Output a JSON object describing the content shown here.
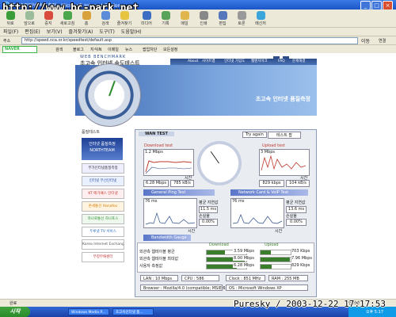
{
  "window": {
    "title": "Microsoft Internet Explorer",
    "title_prefix": "초고속인터넷 속도측정"
  },
  "watermark": "http://www.bc-park.net",
  "credit": "Puresky / 2003-12-22 17:17:53",
  "toolbar": {
    "items": [
      "뒤로",
      "앞으로",
      "중지",
      "새로고침",
      "홈",
      "검색",
      "즐겨찾기",
      "미디어",
      "기록",
      "메일",
      "인쇄",
      "편집",
      "토론",
      "메신저"
    ]
  },
  "menubar": [
    "파일(F)",
    "편집(E)",
    "보기(V)",
    "즐겨찾기(A)",
    "도구(T)",
    "도움말(H)"
  ],
  "address": {
    "label": "주소",
    "value": "http://speed.nca.or.kr/speedtest/default.asp",
    "go": "이동",
    "links": "연결"
  },
  "linkbar": {
    "search_brand": "NAVER",
    "search_label": "검색",
    "items": [
      "블로그",
      "지식iN",
      "이메일",
      "뉴스",
      "팝업차단",
      "모든설정"
    ]
  },
  "site": {
    "logo": "WEB BENCHMARK",
    "subtitle": "초고속 인터넷 속도테스트",
    "nav": [
      "About",
      "사이트맵",
      "인터넷 가입도",
      "웹벤치마크",
      "FAQ",
      "문제해결"
    ],
    "banner": "초고속 인터넷 품질측정"
  },
  "side": {
    "heading": "품질테스트",
    "big": [
      "인터넷 품질측정",
      "NORTHTEAM"
    ],
    "items": [
      "부가인터넷품질측정",
      "인터넷 무선인터넷",
      "KT 메가패스 인터넷",
      "온세통신 Hanafos",
      "하나로통신 하나포스",
      "두루넷 TV 서비스",
      "Korea Internet Exchange",
      "부정부패센터"
    ]
  },
  "panel": {
    "tab": "WAN TEST",
    "try_again": "Try again",
    "tab2": "테스트 팝",
    "download": {
      "title": "Download test",
      "unit_top": "1.2 Mbps",
      "time": "시간",
      "speed": "6.28 Mbps",
      "bytes": "785 kB/s"
    },
    "upload": {
      "title": "Upload test",
      "unit_top": "3 Mbps",
      "time": "시간",
      "speed": "829 kbps",
      "bytes": "104 kB/s"
    },
    "strips": [
      "General Ping Test",
      "Network Card & VoIP Test",
      "Bandwidth Gauge"
    ],
    "ping_left": {
      "axis": "76 ms",
      "avg_label": "평균 지연값",
      "avg": "11.5 ms",
      "loss_label": "손실율",
      "loss": "0.00%",
      "time": "시간"
    },
    "ping_right": {
      "axis": "76 ms",
      "avg_label": "평균 지연값",
      "avg": "13.6 ms",
      "loss_label": "손실율",
      "loss": "0.00%",
      "time": "시간"
    },
    "compare": {
      "head_down": "Download",
      "head_up": "Upload",
      "rows": [
        {
          "label": "외관측 웹테이블 평균",
          "down": "3.59 Mbps",
          "down_frac": 0.45,
          "up": "703 Kbps",
          "up_frac": 0.35
        },
        {
          "label": "외관측 웹테이블 최대값",
          "down": "8.00 Mbps",
          "down_frac": 0.95,
          "up": "7.96 Mbps",
          "up_frac": 0.98
        },
        {
          "label": "사용자 측정값",
          "down": "6.28 Mbps",
          "down_frac": 0.75,
          "up": "829 Kbps",
          "up_frac": 0.38
        }
      ]
    },
    "info": [
      {
        "key": "LAN",
        "value": "10 Mbps"
      },
      {
        "key": "CPU",
        "value": "586"
      },
      {
        "key": "Clock",
        "value": "851 MHz"
      },
      {
        "key": "RAM",
        "value": "255 MB"
      },
      {
        "key": "Browser",
        "value": "Mozilla/4.0 (compatible; MSIE 6.0)"
      },
      {
        "key": "OS",
        "value": "Microsoft Windows XP"
      }
    ]
  },
  "status": {
    "text": "완료",
    "zone": "인터넷"
  },
  "taskbar": {
    "start": "시작",
    "tasks": [
      "Windows Media P...",
      "초고속인터넷 품..."
    ],
    "clock": "오후 5:17"
  },
  "colors": {
    "download_fill": "#3a7d2c",
    "upload_fill": "#3a7d2c",
    "strip": "#5a76c8",
    "title": "#1b55c8"
  }
}
